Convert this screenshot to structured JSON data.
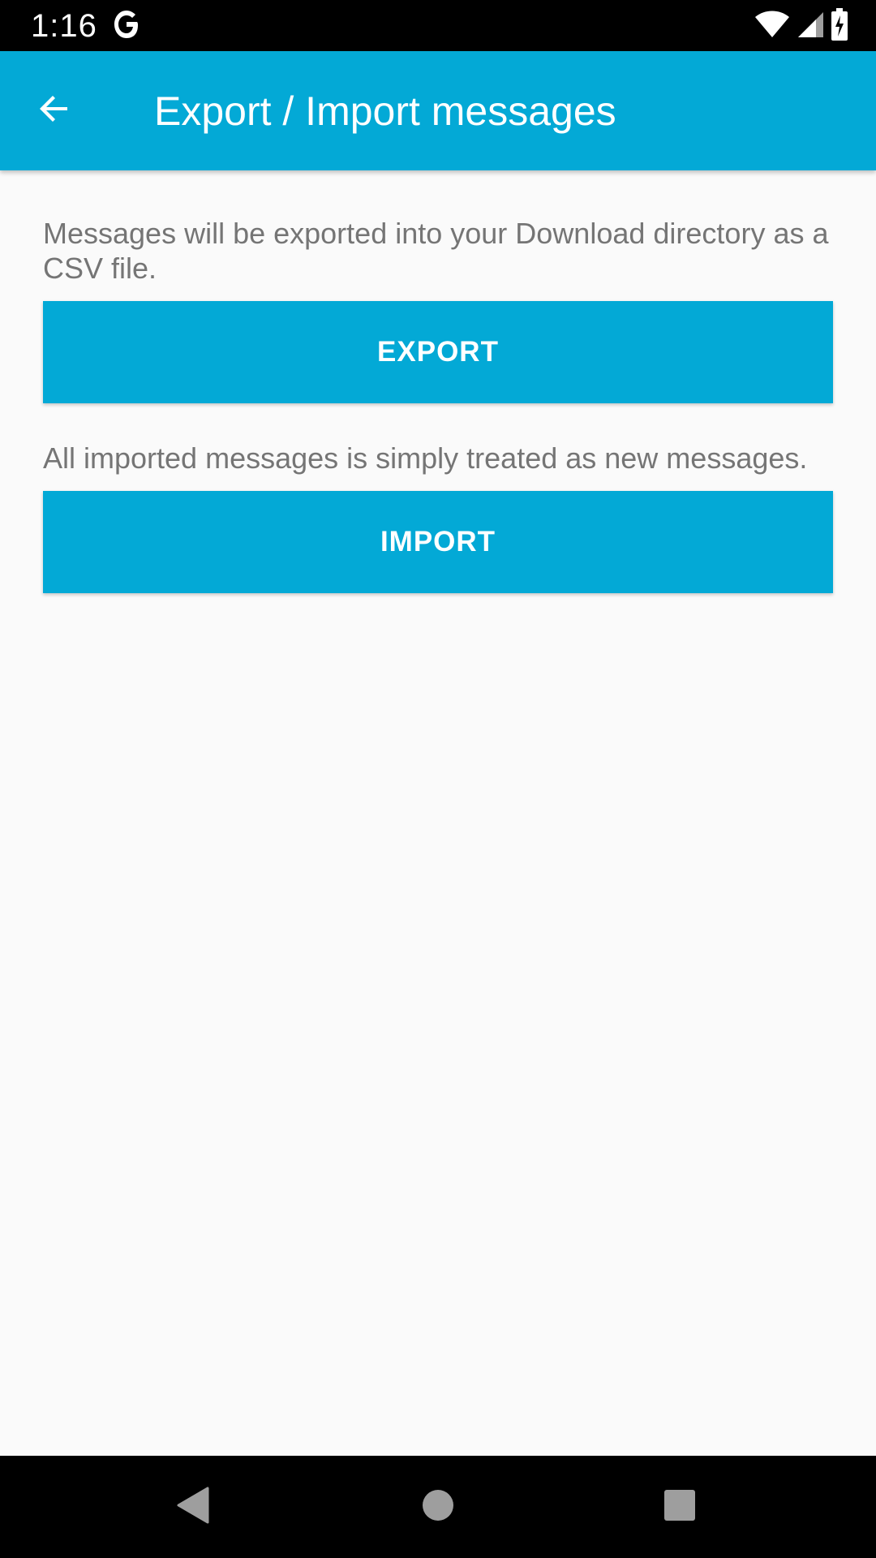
{
  "status_bar": {
    "time": "1:16",
    "icons": [
      "google-g-icon",
      "wifi-icon",
      "signal-icon",
      "battery-charging-icon"
    ]
  },
  "app_bar": {
    "title": "Export / Import messages",
    "back_icon": "arrow-back-icon",
    "color": "#03a9d6"
  },
  "export_section": {
    "description": "Messages will be exported into your Download directory as a CSV file.",
    "button_label": "EXPORT"
  },
  "import_section": {
    "description": "All imported messages is simply treated as new messages.",
    "button_label": "IMPORT"
  },
  "nav_bar": {
    "icons": [
      "nav-back-icon",
      "nav-home-icon",
      "nav-recents-icon"
    ]
  }
}
